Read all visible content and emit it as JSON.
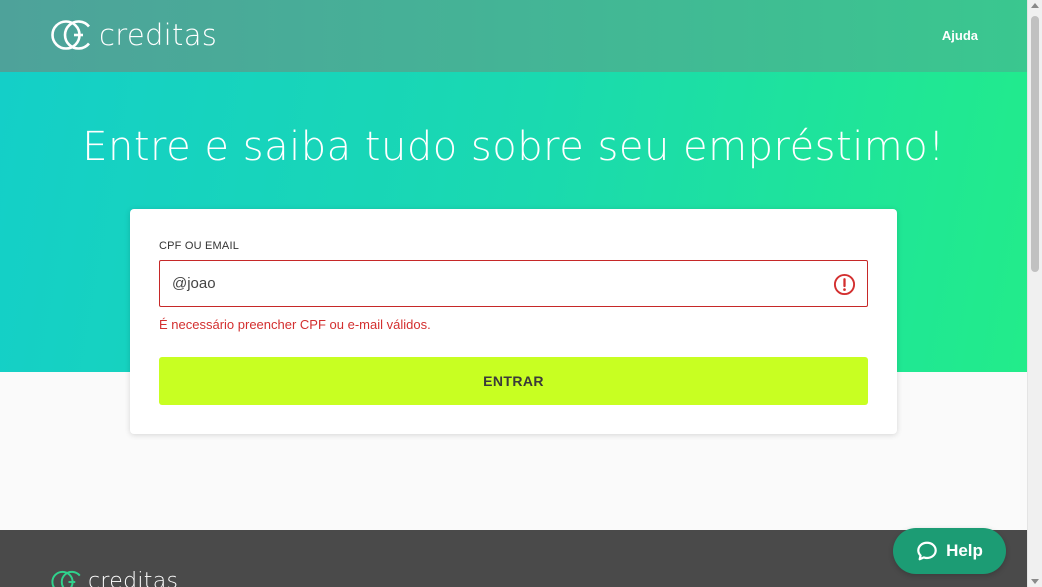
{
  "header": {
    "brand": "creditas",
    "help_link": "Ajuda"
  },
  "hero": {
    "title": "Entre e saiba tudo sobre seu empréstimo!"
  },
  "login": {
    "field_label": "CPF OU EMAIL",
    "field_value": "@joao",
    "error_message": "É necessário preencher CPF ou e-mail válidos.",
    "submit_label": "ENTRAR"
  },
  "footer": {
    "brand": "creditas"
  },
  "help_widget": {
    "label": "Help"
  },
  "icons": {
    "brand": "creditas-logo-icon",
    "field_error": "alert-circle-icon",
    "help": "chat-bubble-icon"
  },
  "colors": {
    "hero_start": "#14cfc8",
    "hero_end": "#22ec8a",
    "error": "#d32f2f",
    "cta": "#c8ff22",
    "help_widget": "#1c9c74",
    "footer": "#4a4a4a"
  }
}
